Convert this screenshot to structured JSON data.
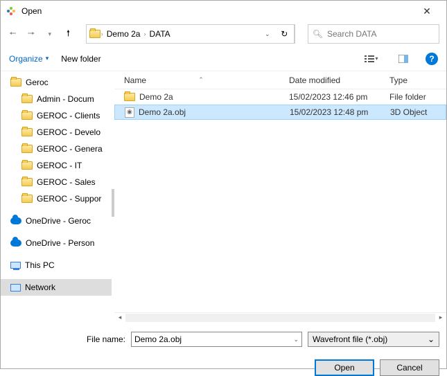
{
  "window": {
    "title": "Open"
  },
  "nav": {
    "breadcrumbs": [
      "Demo 2a",
      "DATA"
    ]
  },
  "search": {
    "placeholder": "Search DATA"
  },
  "toolbar": {
    "organize": "Organize",
    "newfolder": "New folder"
  },
  "tree": {
    "root": "Geroc",
    "folders": [
      "Admin - Docum",
      "GEROC - Clients",
      "GEROC - Develo",
      "GEROC - Genera",
      "GEROC - IT",
      "GEROC - Sales",
      "GEROC - Suppor"
    ],
    "clouds": [
      "OneDrive - Geroc",
      "OneDrive - Person"
    ],
    "pc": "This PC",
    "network": "Network"
  },
  "columns": {
    "name": "Name",
    "date": "Date modified",
    "type": "Type"
  },
  "rows": [
    {
      "icon": "folder",
      "name": "Demo 2a",
      "date": "15/02/2023 12:46 pm",
      "type": "File folder",
      "selected": false
    },
    {
      "icon": "obj",
      "name": "Demo 2a.obj",
      "date": "15/02/2023 12:48 pm",
      "type": "3D Object",
      "selected": true
    }
  ],
  "footer": {
    "label": "File name:",
    "value": "Demo 2a.obj",
    "filter": "Wavefront file (*.obj)",
    "open": "Open",
    "cancel": "Cancel"
  }
}
